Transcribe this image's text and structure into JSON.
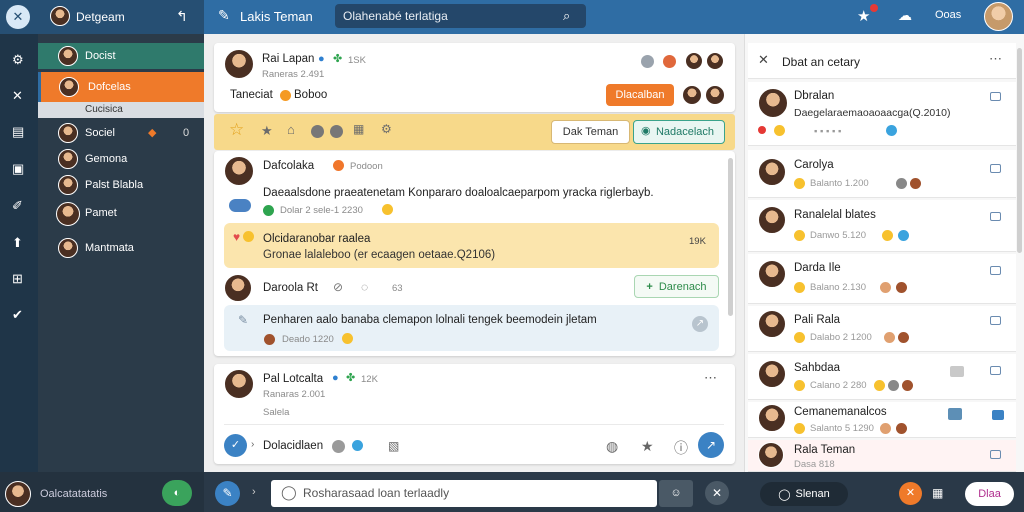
{
  "colors": {
    "accent": "#ef7a2a",
    "brand": "#2f6da4",
    "sidebar": "#2b3b49",
    "highlight": "#f7d98a"
  },
  "topbar": {
    "left_title": "Detgeam",
    "app_title": "Lakis Teman",
    "search_placeholder": "Olahenabé terlatiga",
    "right_label": "Ooas"
  },
  "sidebar": {
    "items": [
      {
        "label": "Docist"
      },
      {
        "label": "Dofcelas"
      },
      {
        "label": "Cucisica"
      },
      {
        "label": "Sociel",
        "badge": "0"
      },
      {
        "label": "Gemona"
      },
      {
        "label": "Palst Blabla"
      },
      {
        "label": "Pamet"
      },
      {
        "label": "Mantmata"
      }
    ],
    "footer_label": "Oalcatatatatis"
  },
  "composer": {
    "name": "Rai Lapan",
    "verify": "1SK",
    "sub": "Raneras 2.491",
    "title": "Taneciat",
    "stat": "Boboo",
    "orange_button": "Dlacalban"
  },
  "toolbar": {
    "btn_plain": "Dak Teman",
    "btn_teal": "Nadacelach"
  },
  "post1": {
    "name": "Dafcolaka",
    "tag": "Podoon",
    "text": "Daeaalsdone praeatenetam Konpararo doaloalcaeparpom yracka riglerbayb.",
    "chip": "Dolar 2 sele-1 2230",
    "quote_name": "Olcidaranobar raalea",
    "quote_count": "19K",
    "quote_text": "Gronae lalaleboo (er ecaagen oetaae.Q2106)"
  },
  "reply": {
    "name": "Daroola Rt",
    "count": "63",
    "button": "Darenach",
    "text": "Penharen aalo banaba clemapon lolnali tengek beemodein jletam",
    "meta": "Deado 1220"
  },
  "post2": {
    "name": "Pal Lotcalta",
    "verify": "12K",
    "sub": "Ranaras 2.001",
    "sub2": "Salela",
    "action_label": "Dolacidlaen"
  },
  "right_panel": {
    "title": "Dbat an cetary",
    "items": [
      {
        "name": "Dbralan",
        "meta": "Daegelaraemaoaoaacga(Q.2010)"
      },
      {
        "name": "Carolya",
        "meta": "Balanto 1.200"
      },
      {
        "name": "Ranalelal blates",
        "meta": "Danwo 5.120"
      },
      {
        "name": "Darda Ile",
        "meta": "Balano 2.130"
      },
      {
        "name": "Pali Rala",
        "meta": "Dalabo 2 1200"
      },
      {
        "name": "Sahbdaa",
        "meta": "Calano 2 280"
      },
      {
        "name": "Cemanemanalcos",
        "meta": "Salanto 5 1290"
      },
      {
        "name": "Rala Teman",
        "meta": "Dasa 818"
      }
    ]
  },
  "bottom": {
    "input_placeholder": "Rosharasaad loan terlaadly",
    "btn_dark": "Slenan",
    "btn_pill": "Dlaa"
  }
}
